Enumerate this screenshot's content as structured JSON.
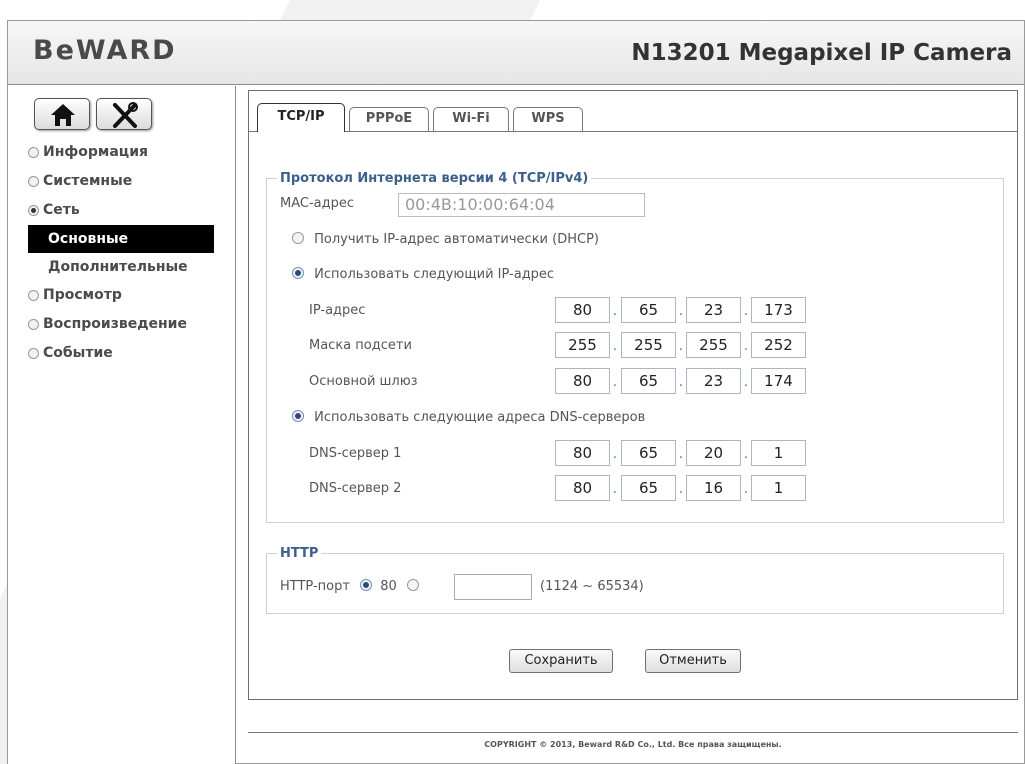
{
  "header": {
    "logo": "BeWARD",
    "camera_title": "N13201 Megapixel IP Camera"
  },
  "sidebar": {
    "items": [
      {
        "label": "Информация",
        "state": "collapsed"
      },
      {
        "label": "Системные",
        "state": "collapsed"
      },
      {
        "label": "Сеть",
        "state": "expanded"
      },
      {
        "label": "Основные",
        "active": true
      },
      {
        "label": "Дополнительные"
      },
      {
        "label": "Просмотр",
        "state": "collapsed"
      },
      {
        "label": "Воспроизведение",
        "state": "collapsed"
      },
      {
        "label": "Событие",
        "state": "collapsed"
      }
    ]
  },
  "tabs": [
    "TCP/IP",
    "PPPoE",
    "Wi-Fi",
    "WPS"
  ],
  "tcpip": {
    "legend": "Протокол Интернета версии 4 (TCP/IPv4)",
    "mac_label": "MAC-адрес",
    "mac_value": "00:4B:10:00:64:04",
    "dhcp_label": "Получить IP-адрес автоматически (DHCP)",
    "static_label": "Использовать следующий IP-адрес",
    "ip_label": "IP-адрес",
    "ip": [
      "80",
      "65",
      "23",
      "173"
    ],
    "mask_label": "Маска подсети",
    "mask": [
      "255",
      "255",
      "255",
      "252"
    ],
    "gateway_label": "Основной шлюз",
    "gateway": [
      "80",
      "65",
      "23",
      "174"
    ],
    "dns_mode_label": "Использовать следующие адреса DNS-серверов",
    "dns1_label": "DNS-сервер 1",
    "dns1": [
      "80",
      "65",
      "20",
      "1"
    ],
    "dns2_label": "DNS-сервер 2",
    "dns2": [
      "80",
      "65",
      "16",
      "1"
    ],
    "dot": "."
  },
  "http": {
    "legend": "HTTP",
    "port_label": "HTTP-порт",
    "default_port": "80",
    "range_hint": "(1124 ~ 65534)"
  },
  "actions": {
    "save": "Сохранить",
    "cancel": "Отменить"
  },
  "footer": "COPYRIGHT © 2013, Beward R&D Co., Ltd. Все права защищены.",
  "colors": {
    "legend": "#3c5f8c",
    "active_menu_bg": "#000000",
    "watermark": "#eeeeee"
  }
}
